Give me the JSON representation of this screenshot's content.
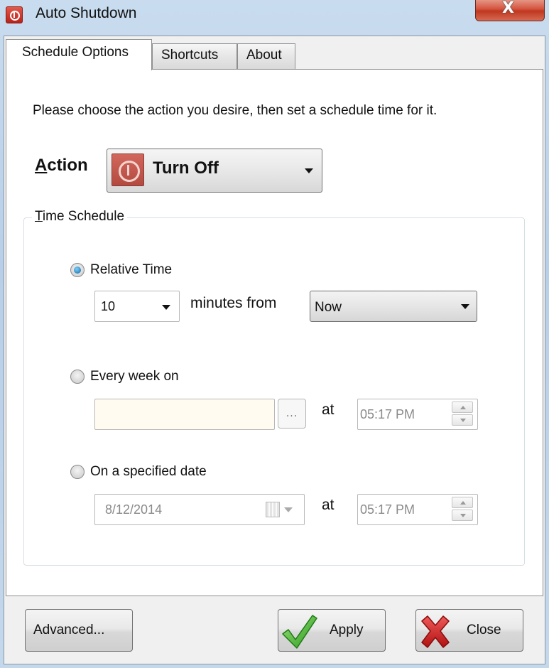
{
  "window": {
    "title": "Auto Shutdown",
    "close_glyph": "X"
  },
  "tabs": [
    {
      "label": "Schedule Options",
      "active": true
    },
    {
      "label": "Shortcuts",
      "active": false
    },
    {
      "label": "About",
      "active": false
    }
  ],
  "schedule": {
    "intro": "Please choose the action you desire, then set a schedule time for it.",
    "action_label_accel": "A",
    "action_label_rest": "ction",
    "action_value": "Turn Off",
    "action_icon": "power-icon",
    "group_title_accel": "T",
    "group_title_rest": "ime Schedule",
    "relative": {
      "label": "Relative Time",
      "checked": true,
      "minutes_value": "10",
      "minutes_from_label": "minutes from",
      "from_value": "Now"
    },
    "weekly": {
      "label": "Every week on",
      "checked": false,
      "days_value": "",
      "browse_label": "...",
      "at_label": "at",
      "time_value": "05:17 PM"
    },
    "specified": {
      "label": "On a specified date",
      "checked": false,
      "date_value": "8/12/2014",
      "at_label": "at",
      "time_value": "05:17 PM"
    }
  },
  "buttons": {
    "advanced": "Advanced...",
    "apply": "Apply",
    "close": "Close"
  },
  "colors": {
    "action_icon_bg": "#c0544a",
    "weekly_field_bg": "#fffbf0",
    "apply_check": "#3fae2a",
    "close_x": "#d42020"
  }
}
